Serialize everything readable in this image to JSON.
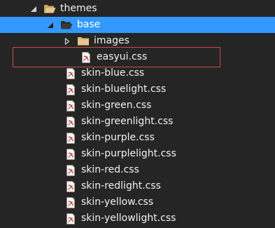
{
  "tree": {
    "themes": {
      "label": "themes",
      "icon": "folder-open-icon",
      "expanded": true
    },
    "base": {
      "label": "base",
      "icon": "folder-open-icon",
      "expanded": true,
      "selected": true
    },
    "images": {
      "label": "images",
      "icon": "folder-icon",
      "expanded": false
    },
    "files": [
      {
        "label": "easyui.css",
        "icon": "css-file-icon"
      },
      {
        "label": "skin-blue.css",
        "icon": "css-file-icon"
      },
      {
        "label": "skin-bluelight.css",
        "icon": "css-file-icon"
      },
      {
        "label": "skin-green.css",
        "icon": "css-file-icon"
      },
      {
        "label": "skin-greenlight.css",
        "icon": "css-file-icon"
      },
      {
        "label": "skin-purple.css",
        "icon": "css-file-icon"
      },
      {
        "label": "skin-purplelight.css",
        "icon": "css-file-icon"
      },
      {
        "label": "skin-red.css",
        "icon": "css-file-icon"
      },
      {
        "label": "skin-redlight.css",
        "icon": "css-file-icon"
      },
      {
        "label": "skin-yellow.css",
        "icon": "css-file-icon"
      },
      {
        "label": "skin-yellowlight.css",
        "icon": "css-file-icon"
      }
    ]
  },
  "colors": {
    "background": "#252526",
    "selection": "#3399ff",
    "text": "#f1f1f1",
    "folder": "#dcb67a",
    "highlight_border": "#c84a4a"
  }
}
